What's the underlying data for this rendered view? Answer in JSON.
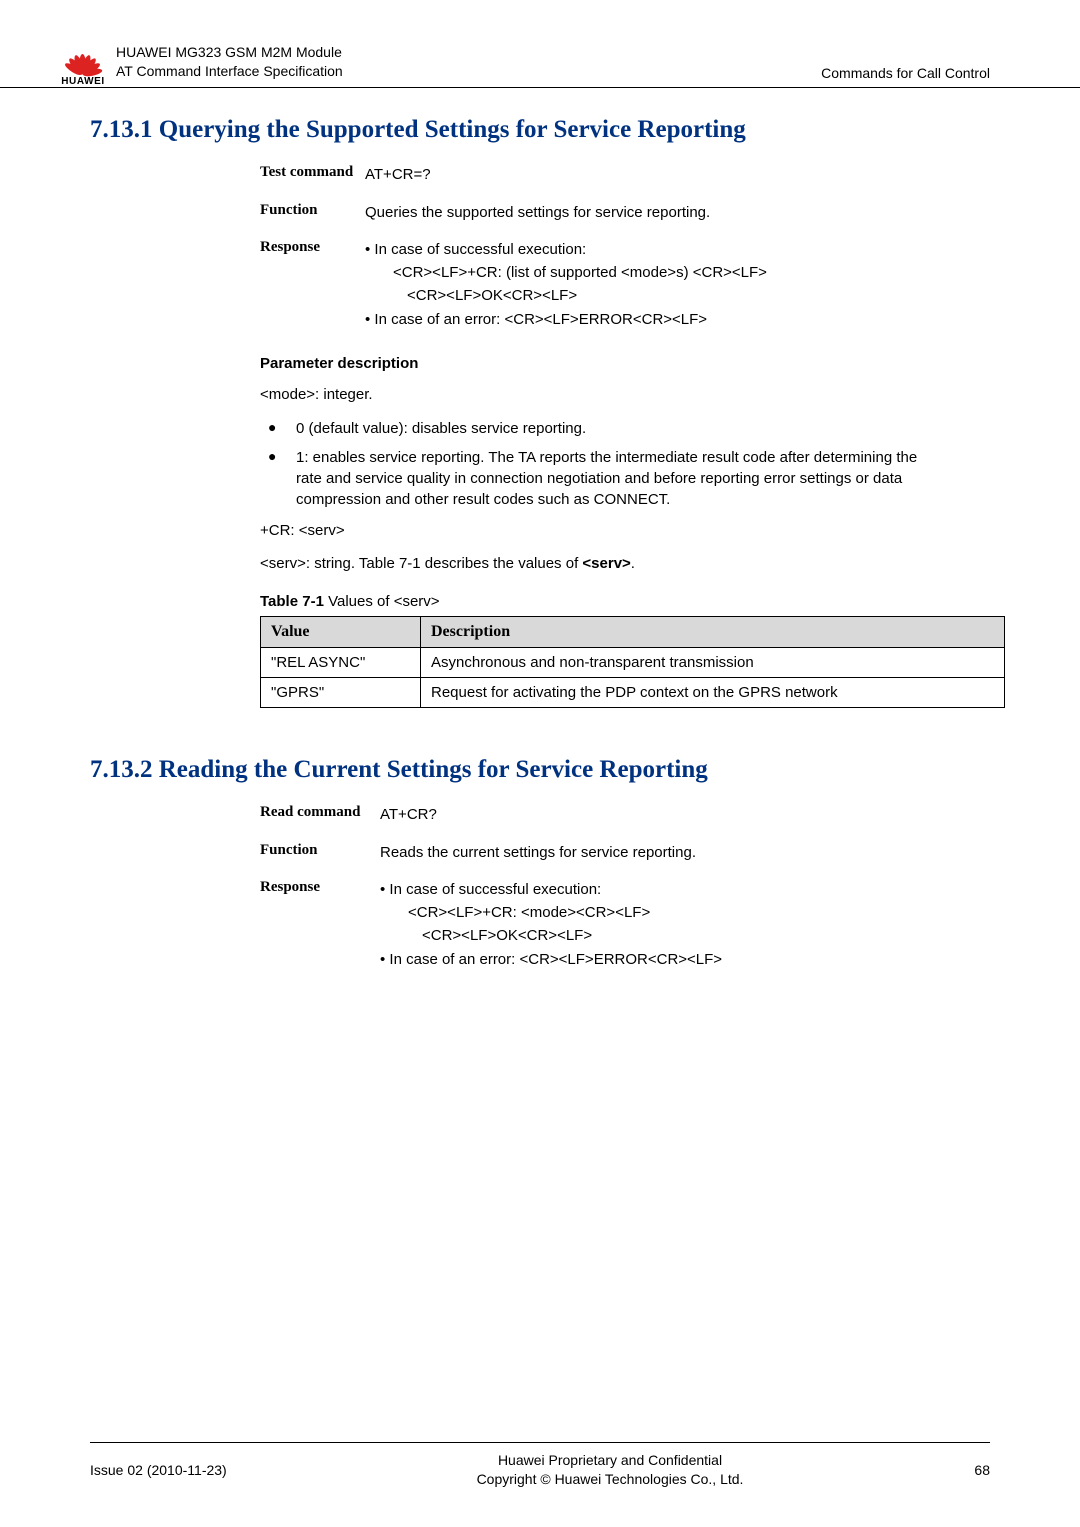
{
  "header": {
    "brand": "HUAWEI",
    "line1": "HUAWEI MG323 GSM M2M Module",
    "line2": "AT Command Interface Specification",
    "right": "Commands for Call Control"
  },
  "section1": {
    "title": "7.13.1 Querying the Supported Settings for Service Reporting",
    "test_label": "Test command",
    "test_value": "AT+CR=?",
    "func_label": "Function",
    "func_value": "Queries the supported settings for service reporting.",
    "resp_label": "Response",
    "resp_b1": "• In case of successful execution:",
    "resp_l1": "<CR><LF>+CR: (list of supported <mode>s) <CR><LF>",
    "resp_l2": "<CR><LF>OK<CR><LF>",
    "resp_b2": "• In case of an error: <CR><LF>ERROR<CR><LF>"
  },
  "param": {
    "heading": "Parameter description",
    "mode_line": "<mode>: integer.",
    "bullet0": "0 (default value): disables service reporting.",
    "bullet1": "1: enables service reporting. The TA reports the intermediate result code after determining the rate and service quality in connection negotiation and before reporting error settings or data compression and other result codes such as CONNECT.",
    "cr_line": "+CR: <serv>",
    "serv_line_pre": "<serv>: string. Table 7-1 describes the values of ",
    "serv_bold": "<serv>",
    "table_caption_b": "Table 7-1 ",
    "table_caption_r": "Values of <serv>",
    "th_value": "Value",
    "th_desc": "Description",
    "rows": [
      {
        "v": "\"REL ASYNC\"",
        "d": "Asynchronous and non-transparent transmission"
      },
      {
        "v": "\"GPRS\"",
        "d": "Request for activating the PDP context on the GPRS network"
      }
    ]
  },
  "section2": {
    "title": "7.13.2 Reading the Current Settings for Service Reporting",
    "read_label": "Read command",
    "read_value": "AT+CR?",
    "func_label": "Function",
    "func_value": "Reads the current settings for service reporting.",
    "resp_label": "Response",
    "resp_b1": "• In case of successful execution:",
    "resp_l1": "<CR><LF>+CR: <mode><CR><LF>",
    "resp_l2": "<CR><LF>OK<CR><LF>",
    "resp_b2": "• In case of an error: <CR><LF>ERROR<CR><LF>"
  },
  "footer": {
    "left": "Issue 02 (2010-11-23)",
    "center1": "Huawei Proprietary and Confidential",
    "center2": "Copyright © Huawei Technologies Co., Ltd.",
    "right": "68"
  }
}
